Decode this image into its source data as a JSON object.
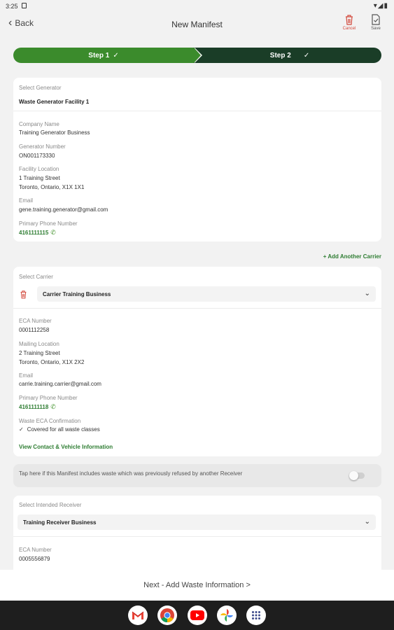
{
  "status_bar": {
    "time": "3:25",
    "icons": "▾◢▮"
  },
  "app_bar": {
    "back_label": "Back",
    "title": "New Manifest",
    "cancel_label": "Cancel",
    "save_label": "Save"
  },
  "stepper": {
    "step1": "Step 1",
    "step2": "Step 2",
    "check": "✓"
  },
  "generator": {
    "select_label": "Select Generator",
    "selected": "Waste Generator Facility 1",
    "company_label": "Company Name",
    "company": "Training Generator Business",
    "number_label": "Generator Number",
    "number": "ON001173330",
    "location_label": "Facility Location",
    "address1": "1 Training Street",
    "address2": "Toronto, Ontario, X1X 1X1",
    "email_label": "Email",
    "email": "gene.training.generator@gmail.com",
    "phone_label": "Primary Phone Number",
    "phone": "4161111115"
  },
  "add_carrier": "+ Add Another Carrier",
  "carrier": {
    "select_label": "Select Carrier",
    "selected": "Carrier Training Business",
    "eca_label": "ECA Number",
    "eca": "0001112258",
    "location_label": "Mailing Location",
    "address1": "2 Training Street",
    "address2": "Toronto, Ontario, X1X 2X2",
    "email_label": "Email",
    "email": "carrie.training.carrier@gmail.com",
    "phone_label": "Primary Phone Number",
    "phone": "4161111118",
    "waste_eca_label": "Waste ECA Confirmation",
    "waste_eca": "Covered for all waste classes",
    "contact_link": "View Contact & Vehicle Information"
  },
  "refused": {
    "text": "Tap here if this Manifest includes waste which was previously refused by another Receiver",
    "toggle_on": false
  },
  "receiver": {
    "select_label": "Select Intended Receiver",
    "selected": "Training Receiver Business",
    "eca_label": "ECA Number",
    "eca": "0005556879"
  },
  "next_button": "Next - Add Waste Information  >",
  "dock_apps": [
    "gmail-icon",
    "chrome-icon",
    "youtube-icon",
    "photos-icon",
    "app-drawer-icon"
  ],
  "colors": {
    "primary_green": "#3b8b2c",
    "dark_green": "#1a3d27",
    "danger": "#d34a3d"
  }
}
